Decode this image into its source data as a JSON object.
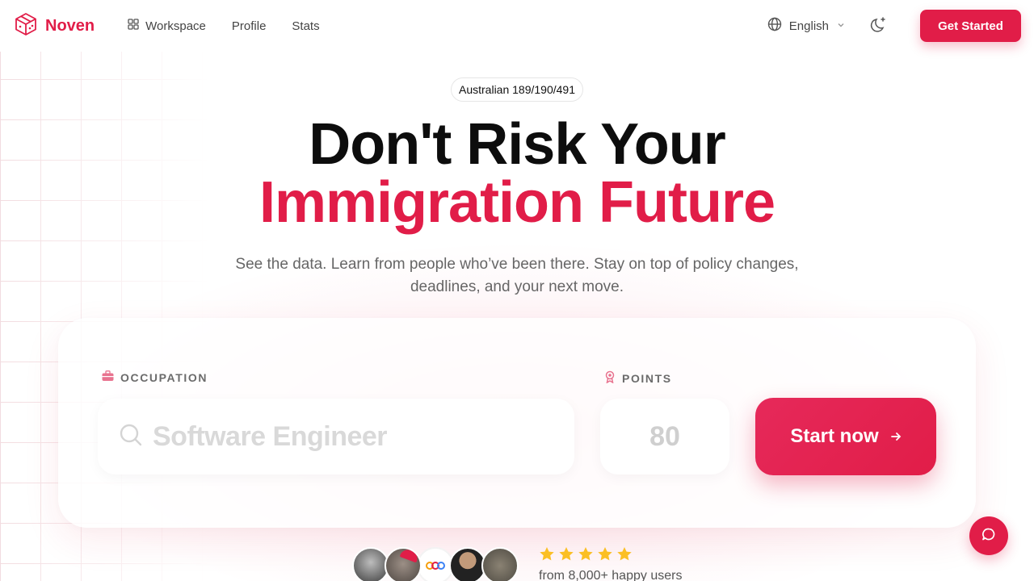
{
  "brand": {
    "name": "Noven",
    "accent": "#e11d48"
  },
  "nav": {
    "items": [
      {
        "label": "Workspace",
        "icon": "grid-icon"
      },
      {
        "label": "Profile"
      },
      {
        "label": "Stats"
      }
    ]
  },
  "header": {
    "language": "English",
    "cta_label": "Get Started"
  },
  "hero": {
    "badge": "Australian 189/190/491",
    "title_line1": "Don't Risk Your",
    "title_line2": "Immigration Future",
    "subtitle": "See the data. Learn from people who’ve been there. Stay on top of policy changes, deadlines, and your next move."
  },
  "form": {
    "occupation_label": "OCCUPATION",
    "occupation_placeholder": "Software Engineer",
    "points_label": "POINTS",
    "points_placeholder": "80",
    "submit_label": "Start now"
  },
  "social_proof": {
    "rating": 5,
    "text": "from 8,000+ happy users"
  }
}
